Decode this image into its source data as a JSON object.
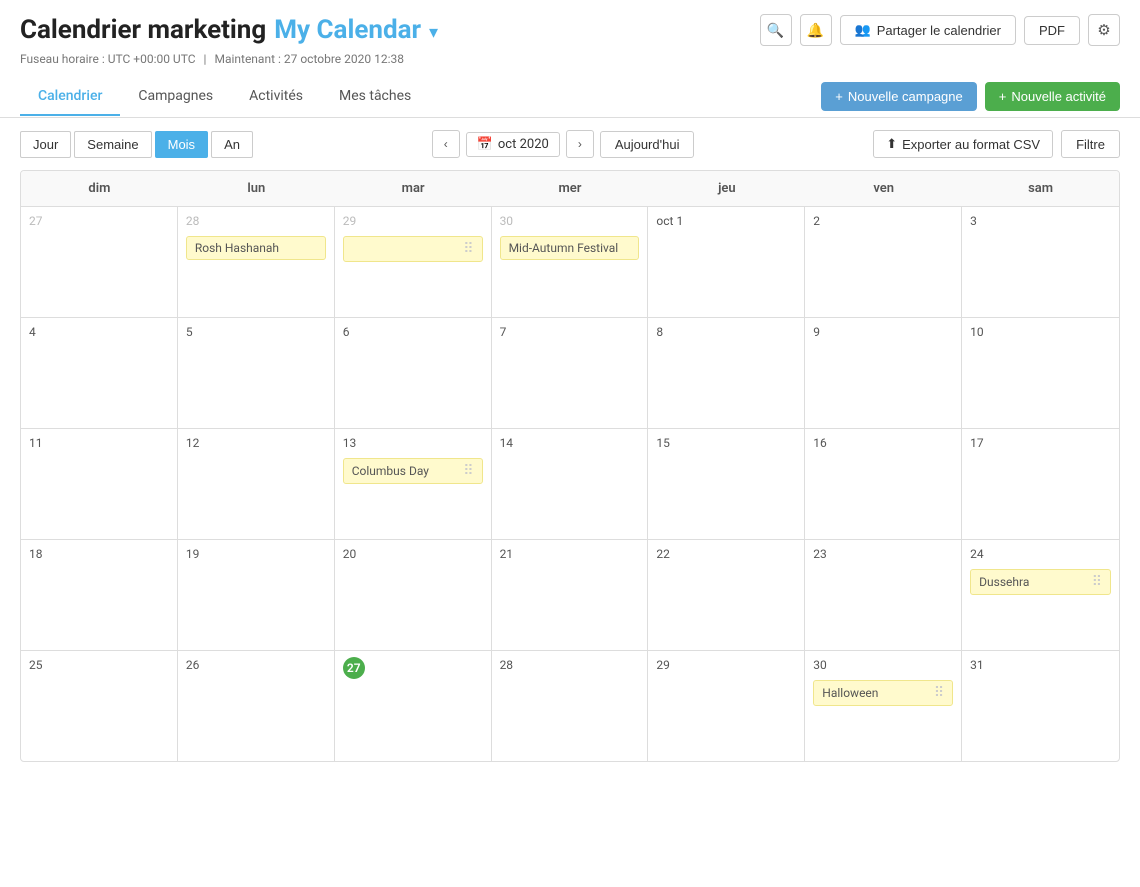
{
  "header": {
    "title_main": "Calendrier marketing",
    "title_calendar": "My Calendar",
    "title_chevron": "▾",
    "timezone": "Fuseau horaire : UTC +00:00 UTC",
    "now": "Maintenant : 27 octobre 2020 12:38",
    "share_btn": "Partager le calendrier",
    "pdf_btn": "PDF"
  },
  "tabs": {
    "items": [
      "Calendrier",
      "Campagnes",
      "Activités",
      "Mes tâches"
    ],
    "active": "Calendrier",
    "new_campaign": "+ Nouvelle campagne",
    "new_activity": "+ Nouvelle activité"
  },
  "toolbar": {
    "view_day": "Jour",
    "view_week": "Semaine",
    "view_month": "Mois",
    "view_year": "An",
    "active_view": "Mois",
    "nav_prev": "‹",
    "nav_next": "›",
    "current_month": "oct 2020",
    "calendar_icon": "📅",
    "today_btn": "Aujourd'hui",
    "export_btn": "Exporter au format CSV",
    "filter_btn": "Filtre"
  },
  "calendar": {
    "headers": [
      "dim",
      "lun",
      "mar",
      "mer",
      "jeu",
      "ven",
      "sam"
    ],
    "weeks": [
      {
        "days": [
          {
            "num": "27",
            "other": true,
            "events": []
          },
          {
            "num": "28",
            "other": true,
            "events": [
              {
                "label": "Rosh Hashanah",
                "style": "yellow"
              }
            ]
          },
          {
            "num": "29",
            "other": true,
            "events": [
              {
                "label": "",
                "style": "yellow-pattern"
              }
            ]
          },
          {
            "num": "30",
            "other": true,
            "events": [
              {
                "label": "Mid-Autumn Festival",
                "style": "yellow"
              }
            ]
          },
          {
            "num": "oct 1",
            "events": []
          },
          {
            "num": "2",
            "events": []
          },
          {
            "num": "3",
            "events": []
          }
        ]
      },
      {
        "days": [
          {
            "num": "4",
            "events": []
          },
          {
            "num": "5",
            "events": []
          },
          {
            "num": "6",
            "events": []
          },
          {
            "num": "7",
            "events": []
          },
          {
            "num": "8",
            "events": []
          },
          {
            "num": "9",
            "events": []
          },
          {
            "num": "10",
            "events": []
          }
        ]
      },
      {
        "days": [
          {
            "num": "11",
            "events": []
          },
          {
            "num": "12",
            "events": []
          },
          {
            "num": "13",
            "events": [
              {
                "label": "Columbus Day",
                "style": "yellow"
              }
            ]
          },
          {
            "num": "14",
            "events": []
          },
          {
            "num": "15",
            "events": []
          },
          {
            "num": "16",
            "events": []
          },
          {
            "num": "17",
            "events": []
          }
        ]
      },
      {
        "days": [
          {
            "num": "18",
            "events": []
          },
          {
            "num": "19",
            "events": []
          },
          {
            "num": "20",
            "events": []
          },
          {
            "num": "21",
            "events": []
          },
          {
            "num": "22",
            "events": []
          },
          {
            "num": "23",
            "events": []
          },
          {
            "num": "24",
            "events": [
              {
                "label": "Dussehra",
                "style": "yellow"
              }
            ]
          }
        ]
      },
      {
        "days": [
          {
            "num": "25",
            "events": []
          },
          {
            "num": "26",
            "events": []
          },
          {
            "num": "27",
            "today": true,
            "events": []
          },
          {
            "num": "28",
            "events": []
          },
          {
            "num": "29",
            "events": []
          },
          {
            "num": "30",
            "events": [
              {
                "label": "Halloween",
                "style": "yellow"
              }
            ]
          },
          {
            "num": "31",
            "events": []
          }
        ]
      }
    ]
  }
}
